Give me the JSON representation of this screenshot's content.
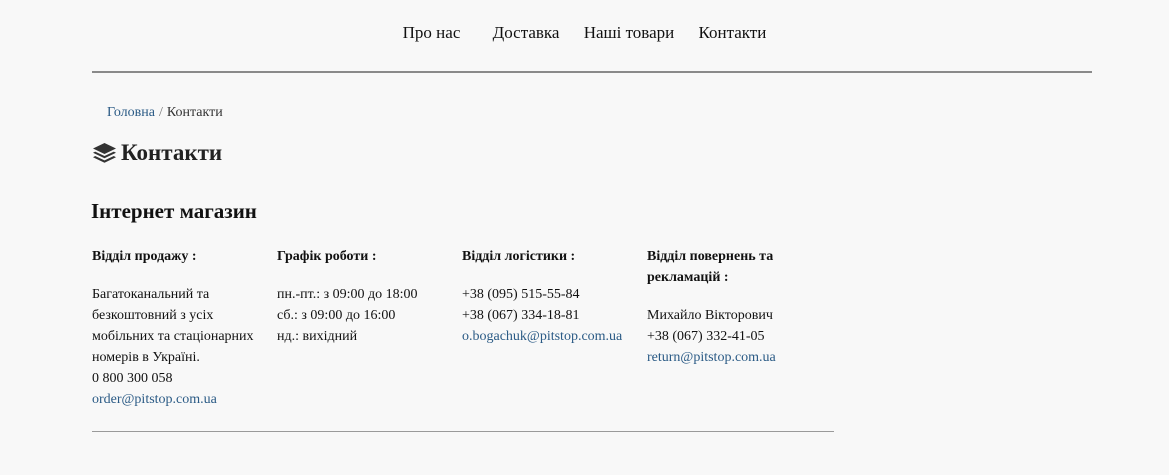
{
  "nav": {
    "items": [
      {
        "label": "Про нас"
      },
      {
        "label": "Доставка"
      },
      {
        "label": "Наші товари"
      },
      {
        "label": "Контакти"
      }
    ]
  },
  "breadcrumb": {
    "home": "Головна",
    "separator": "/",
    "current": "Контакти"
  },
  "page": {
    "title": "Контакти",
    "title_icon": "layers-icon",
    "section_title": "Інтернет магазин"
  },
  "columns": {
    "sales": {
      "heading": "Відділ продажу :",
      "lines": [
        "Багатоканальний та",
        "безкоштовний з усіх",
        "мобільних та стаціонарних",
        "номерів в Україні."
      ],
      "phone": "0 800 300 058",
      "email": "order@pitstop.com.ua"
    },
    "schedule": {
      "heading": "Графік роботи :",
      "lines": [
        "пн.-пт.: з 09:00 до 18:00",
        "сб.: з 09:00 до 16:00",
        "нд.: вихідний"
      ]
    },
    "logistics": {
      "heading": "Відділ логістики :",
      "phone1": "+38 (095) 515-55-84",
      "phone2": "+38 (067) 334-18-81",
      "email": "o.bogachuk@pitstop.com.ua"
    },
    "returns": {
      "heading_line1": "Відділ повернень та",
      "heading_line2": "рекламацій :",
      "name": "Михайло Вікторович",
      "phone": "+38 (067) 332-41-05",
      "email": "return@pitstop.com.ua"
    }
  },
  "colors": {
    "link": "#2a5a85",
    "background": "#f8f8f8"
  }
}
